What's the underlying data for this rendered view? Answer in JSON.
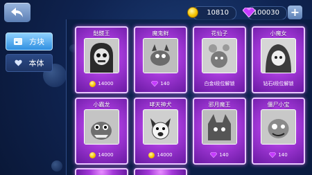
{
  "currency": {
    "coins": "10810",
    "gems": "100030"
  },
  "tabs": [
    {
      "label": "方块",
      "icon": "block-icon",
      "active": true
    },
    {
      "label": "本体",
      "icon": "heart-icon",
      "active": false
    }
  ],
  "cards": [
    {
      "name": "骷髅王",
      "cost": "14000",
      "currency": "coin"
    },
    {
      "name": "魔鬼鲜",
      "cost": "140",
      "currency": "gem"
    },
    {
      "name": "花仙子",
      "cost": "白金I段位解锁",
      "currency": "none"
    },
    {
      "name": "小魔女",
      "cost": "钻石I段位解锁",
      "currency": "none"
    },
    {
      "name": "小霸龙",
      "cost": "14000",
      "currency": "coin"
    },
    {
      "name": "哮天神犬",
      "cost": "14000",
      "currency": "coin"
    },
    {
      "name": "邪月魔王",
      "cost": "140",
      "currency": "gem"
    },
    {
      "name": "僵尸小宝",
      "cost": "140",
      "currency": "gem"
    }
  ],
  "colors": {
    "accent_gold": "#f5c400",
    "gem_purple": "#c53bff",
    "card_glow": "#e78cff"
  }
}
